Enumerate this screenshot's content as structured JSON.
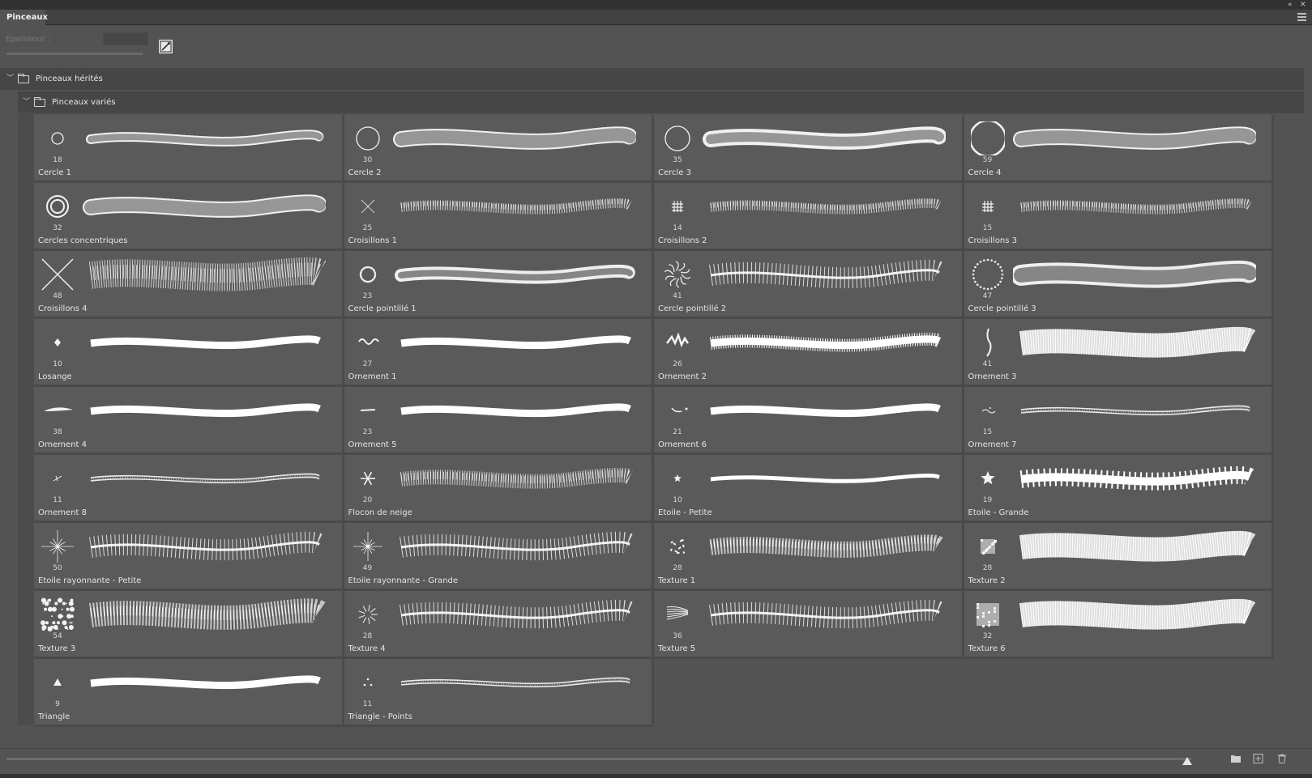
{
  "panel": {
    "tab_label": "Pinceaux"
  },
  "thickness": {
    "label": "Epaisseur :",
    "value": ""
  },
  "groups": [
    {
      "name": "Pinceaux hérités"
    },
    {
      "name": "Pinceaux variés"
    }
  ],
  "brushes": [
    {
      "size": "18",
      "name": "Cercle 1",
      "thumb": "circle",
      "r": 7,
      "stroke": "rings"
    },
    {
      "size": "30",
      "name": "Cercle 2",
      "thumb": "circle",
      "r": 14,
      "stroke": "rings-big"
    },
    {
      "size": "35",
      "name": "Cercle 3",
      "thumb": "circle",
      "r": 15,
      "stroke": "rings-blur"
    },
    {
      "size": "59",
      "name": "Cercle 4",
      "thumb": "circle",
      "r": 22,
      "stroke": "rings-big"
    },
    {
      "size": "32",
      "name": "Cercles concentriques",
      "thumb": "concentric",
      "r": 13,
      "stroke": "rings-big"
    },
    {
      "size": "25",
      "name": "Croisillons 1",
      "thumb": "x-small",
      "r": 8,
      "stroke": "cross"
    },
    {
      "size": "14",
      "name": "Croisillons 2",
      "thumb": "hash",
      "r": 6,
      "stroke": "hash"
    },
    {
      "size": "15",
      "name": "Croisillons 3",
      "thumb": "hash",
      "r": 6,
      "stroke": "hash"
    },
    {
      "size": "48",
      "name": "Croisillons 4",
      "thumb": "x-big",
      "r": 20,
      "stroke": "cross-big"
    },
    {
      "size": "23",
      "name": "Cercle pointillé 1",
      "thumb": "dotcircle",
      "r": 9,
      "stroke": "dots"
    },
    {
      "size": "41",
      "name": "Cercle pointillé 2",
      "thumb": "swirl",
      "r": 16,
      "stroke": "feather"
    },
    {
      "size": "47",
      "name": "Cercle pointillé 3",
      "thumb": "dotcircle",
      "r": 18,
      "stroke": "dots-big"
    },
    {
      "size": "10",
      "name": "Losange",
      "thumb": "diamond",
      "r": 5,
      "stroke": "ribbon"
    },
    {
      "size": "27",
      "name": "Ornement 1",
      "thumb": "wave",
      "r": 10,
      "stroke": "ribbon"
    },
    {
      "size": "26",
      "name": "Ornement 2",
      "thumb": "ornament",
      "r": 12,
      "stroke": "ribbon-rough"
    },
    {
      "size": "41",
      "name": "Ornement 3",
      "thumb": "hook",
      "r": 16,
      "stroke": "band"
    },
    {
      "size": "38",
      "name": "Ornement 4",
      "thumb": "leaf",
      "r": 15,
      "stroke": "ribbon"
    },
    {
      "size": "23",
      "name": "Ornement 5",
      "thumb": "dash",
      "r": 9,
      "stroke": "ribbon"
    },
    {
      "size": "21",
      "name": "Ornement 6",
      "thumb": "hook2",
      "r": 8,
      "stroke": "ribbon"
    },
    {
      "size": "15",
      "name": "Ornement 7",
      "thumb": "squiggle",
      "r": 6,
      "stroke": "thin-double"
    },
    {
      "size": "11",
      "name": "Ornement 8",
      "thumb": "slash",
      "r": 5,
      "stroke": "thin-double"
    },
    {
      "size": "20",
      "name": "Flocon de neige",
      "thumb": "snow",
      "r": 9,
      "stroke": "hash-big"
    },
    {
      "size": "10",
      "name": "Etoile - Petite",
      "thumb": "star",
      "r": 5,
      "stroke": "thin"
    },
    {
      "size": "19",
      "name": "Etoile - Grande",
      "thumb": "star",
      "r": 9,
      "stroke": "jagged"
    },
    {
      "size": "50",
      "name": "Etoile rayonnante - Petite",
      "thumb": "spark",
      "r": 20,
      "stroke": "spark"
    },
    {
      "size": "49",
      "name": "Etoile rayonnante - Grande",
      "thumb": "spark",
      "r": 18,
      "stroke": "spark"
    },
    {
      "size": "28",
      "name": "Texture 1",
      "thumb": "blob",
      "r": 8,
      "stroke": "texture"
    },
    {
      "size": "28",
      "name": "Texture 2",
      "thumb": "blob-sq",
      "r": 9,
      "stroke": "band-soft"
    },
    {
      "size": "54",
      "name": "Texture 3",
      "thumb": "blob-big",
      "r": 18,
      "stroke": "texture-big"
    },
    {
      "size": "28",
      "name": "Texture 4",
      "thumb": "scatter",
      "r": 11,
      "stroke": "feather"
    },
    {
      "size": "36",
      "name": "Texture 5",
      "thumb": "comb",
      "r": 14,
      "stroke": "streaks"
    },
    {
      "size": "32",
      "name": "Texture 6",
      "thumb": "blob-sq",
      "r": 14,
      "stroke": "band-soft"
    },
    {
      "size": "9",
      "name": "Triangle",
      "thumb": "triangle",
      "r": 5,
      "stroke": "ribbon"
    },
    {
      "size": "11",
      "name": "Triangle - Points",
      "thumb": "tri-dots",
      "r": 5,
      "stroke": "thin-double"
    }
  ]
}
